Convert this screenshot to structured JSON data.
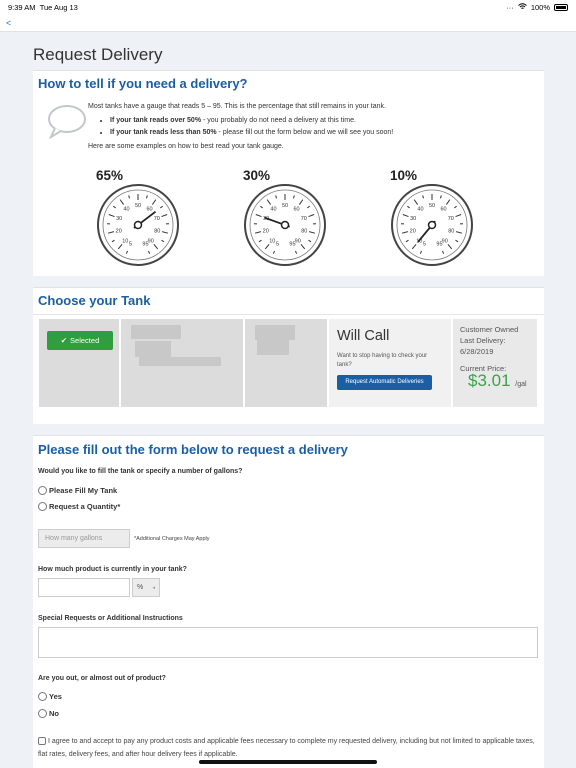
{
  "status": {
    "time": "9:39 AM",
    "date": "Tue Aug 13",
    "battery": "100%"
  },
  "nav": {
    "back": "<"
  },
  "page_title": "Request Delivery",
  "how_to": {
    "heading": "How to tell if you need a delivery?",
    "intro": "Most tanks have a gauge that reads 5 – 95. This is the percentage that still remains in your tank.",
    "bullet1_bold": "If your tank reads over 50%",
    "bullet1_rest": " - you probably do not need a delivery at this time.",
    "bullet2_bold": "If your tank reads less than 50%",
    "bullet2_rest": " - please fill out the form below and we will see you soon!",
    "examples": "Here are some examples on how to best read your tank gauge.",
    "gauges": [
      {
        "label": "65%",
        "value": 65
      },
      {
        "label": "30%",
        "value": 30
      },
      {
        "label": "10%",
        "value": 10
      }
    ],
    "ticks": [
      "5",
      "10",
      "20",
      "30",
      "40",
      "50",
      "60",
      "70",
      "80",
      "90",
      "95"
    ]
  },
  "tank": {
    "heading": "Choose your Tank",
    "selected_label": "Selected",
    "will_call_title": "Will Call",
    "will_call_text": "Want to stop having to check your tank?",
    "auto_button": "Request Automatic Deliveries",
    "owner": "Customer Owned",
    "last_delivery_label": "Last Delivery:",
    "last_delivery_date": "6/28/2019",
    "price_label": "Current Price:",
    "price": "$3.01",
    "price_unit": "/gal"
  },
  "form": {
    "heading": "Please fill out the form below to request a delivery",
    "q_fill": "Would you like to fill the tank or specify a number of gallons?",
    "opt_fill": "Please Fill My Tank",
    "opt_quantity": "Request a Quantity*",
    "gallons_placeholder": "How many gallons",
    "charges_note": "*Additional Charges May Apply",
    "q_current": "How much product is currently in your tank?",
    "pct_unit": "%",
    "special_label": "Special Requests or Additional Instructions",
    "q_out": "Are you out, or almost out of product?",
    "opt_yes": "Yes",
    "opt_no": "No",
    "agree_text": "I agree to and accept to pay any product costs and applicable fees necessary to complete my requested delivery, including but not limited to applicable taxes, flat rates, delivery fees, and after hour delivery fees if applicable."
  },
  "colors": {
    "accent": "#1a5fa6",
    "selected": "#2e9e3e",
    "price": "#3aa34a"
  }
}
